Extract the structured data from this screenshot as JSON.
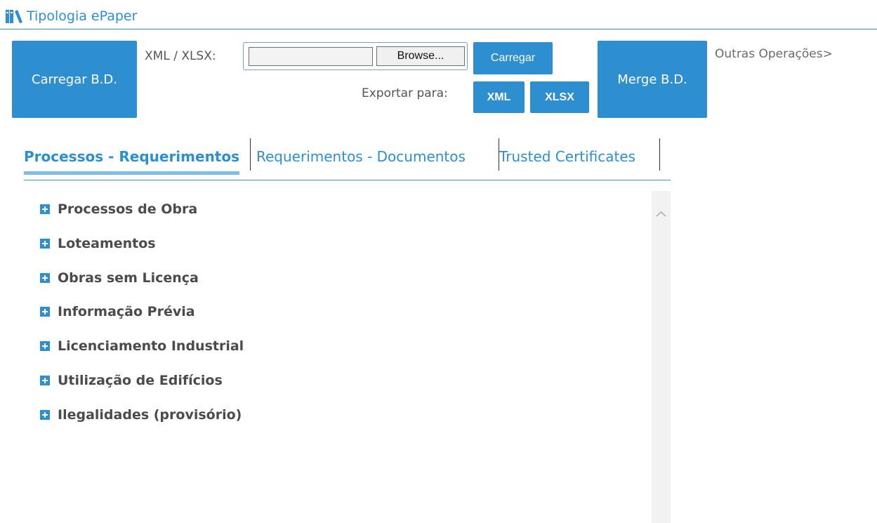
{
  "header": {
    "title": "Tipologia ePaper",
    "logo_icon": "books-icon"
  },
  "toolbar": {
    "load_db_label": "Carregar B.D.",
    "file_label": "XML / XLSX:",
    "file_value": "",
    "browse_label": "Browse...",
    "upload_label": "Carregar",
    "export_label": "Exportar para:",
    "export_xml_label": "XML",
    "export_xlsx_label": "XLSX",
    "merge_label": "Merge B.D.",
    "other_ops_label": "Outras Operações>"
  },
  "tabs": [
    {
      "label": "Processos - Requerimentos",
      "active": true
    },
    {
      "label": "Requerimentos - Documentos",
      "active": false
    },
    {
      "label": "Trusted Certificates",
      "active": false
    }
  ],
  "tree": {
    "expand_icon": "plus-icon",
    "items": [
      {
        "label": "Processos de Obra"
      },
      {
        "label": "Loteamentos"
      },
      {
        "label": "Obras sem Licença"
      },
      {
        "label": "Informação Prévia"
      },
      {
        "label": "Licenciamento Industrial"
      },
      {
        "label": "Utilização de Edifícios"
      },
      {
        "label": "Ilegalidades (provisório)"
      }
    ]
  },
  "colors": {
    "accent": "#2e8fd0",
    "tab_active": "#2b8fd6",
    "tab_underline": "#7fbde8",
    "tree_text": "#4b4b4b"
  }
}
